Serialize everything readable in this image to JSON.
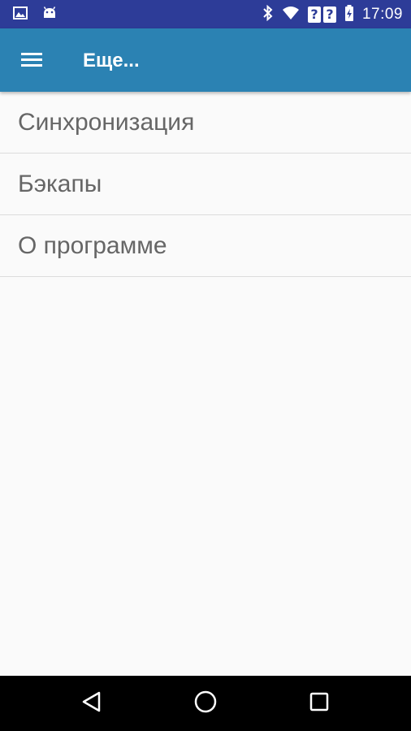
{
  "status_bar": {
    "time": "17:09",
    "left_icons": [
      "image-icon",
      "android-icon"
    ],
    "right_icons": [
      "bluetooth-icon",
      "wifi-icon",
      "unknown-sim-icon",
      "unknown-sim-icon",
      "battery-charging-icon"
    ],
    "sim_glyph": "?",
    "color": "#2d3c98"
  },
  "app_bar": {
    "title": "Еще...",
    "menu_icon": "hamburger-menu-icon",
    "color": "#2b82b3"
  },
  "menu": {
    "items": [
      {
        "label": "Синхронизация"
      },
      {
        "label": "Бэкапы"
      },
      {
        "label": "О программе"
      }
    ]
  },
  "nav_bar": {
    "buttons": [
      "back-icon",
      "home-icon",
      "recents-icon"
    ]
  }
}
